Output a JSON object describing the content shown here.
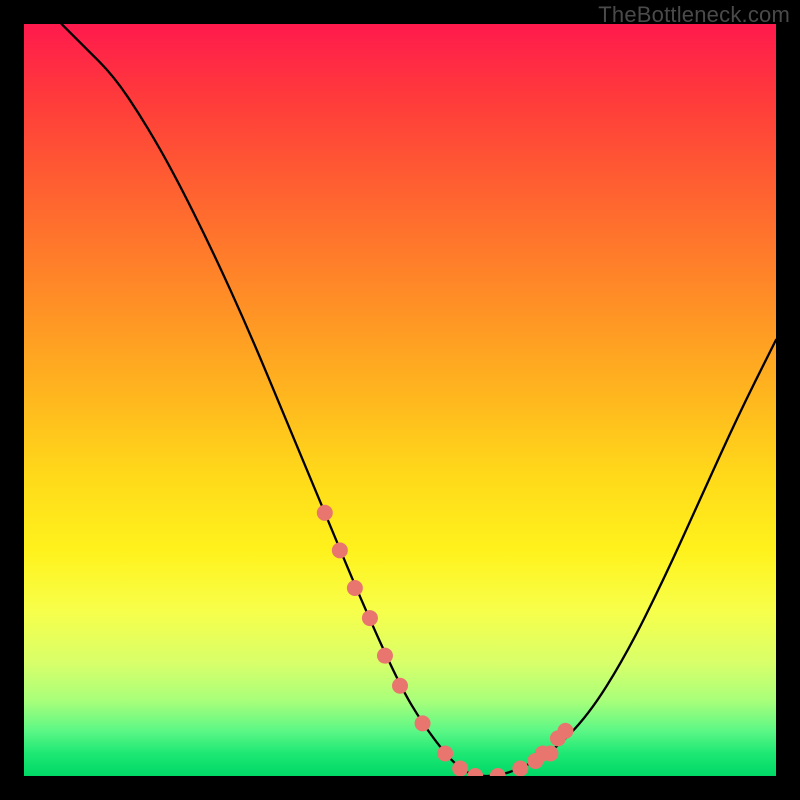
{
  "watermark": "TheBottleneck.com",
  "chart_data": {
    "type": "line",
    "title": "",
    "xlabel": "",
    "ylabel": "",
    "xlim": [
      0,
      100
    ],
    "ylim": [
      0,
      100
    ],
    "series": [
      {
        "name": "bottleneck-curve",
        "x": [
          5,
          8,
          12,
          16,
          20,
          25,
          30,
          35,
          40,
          45,
          50,
          53,
          56,
          58,
          60,
          63,
          66,
          70,
          75,
          80,
          85,
          90,
          95,
          100
        ],
        "y": [
          100,
          97,
          93,
          87,
          80,
          70,
          59,
          47,
          35,
          23,
          12,
          7,
          3,
          1,
          0,
          0,
          1,
          3,
          8,
          16,
          26,
          37,
          48,
          58
        ]
      }
    ],
    "markers": {
      "name": "highlight-dots",
      "color": "#e8766e",
      "points_x": [
        40,
        42,
        44,
        46,
        48,
        50,
        53,
        56,
        58,
        60,
        63,
        66,
        68,
        69,
        70,
        71,
        72
      ],
      "points_y": [
        35,
        30,
        25,
        21,
        16,
        12,
        7,
        3,
        1,
        0,
        0,
        1,
        2,
        3,
        3,
        5,
        6
      ]
    }
  }
}
